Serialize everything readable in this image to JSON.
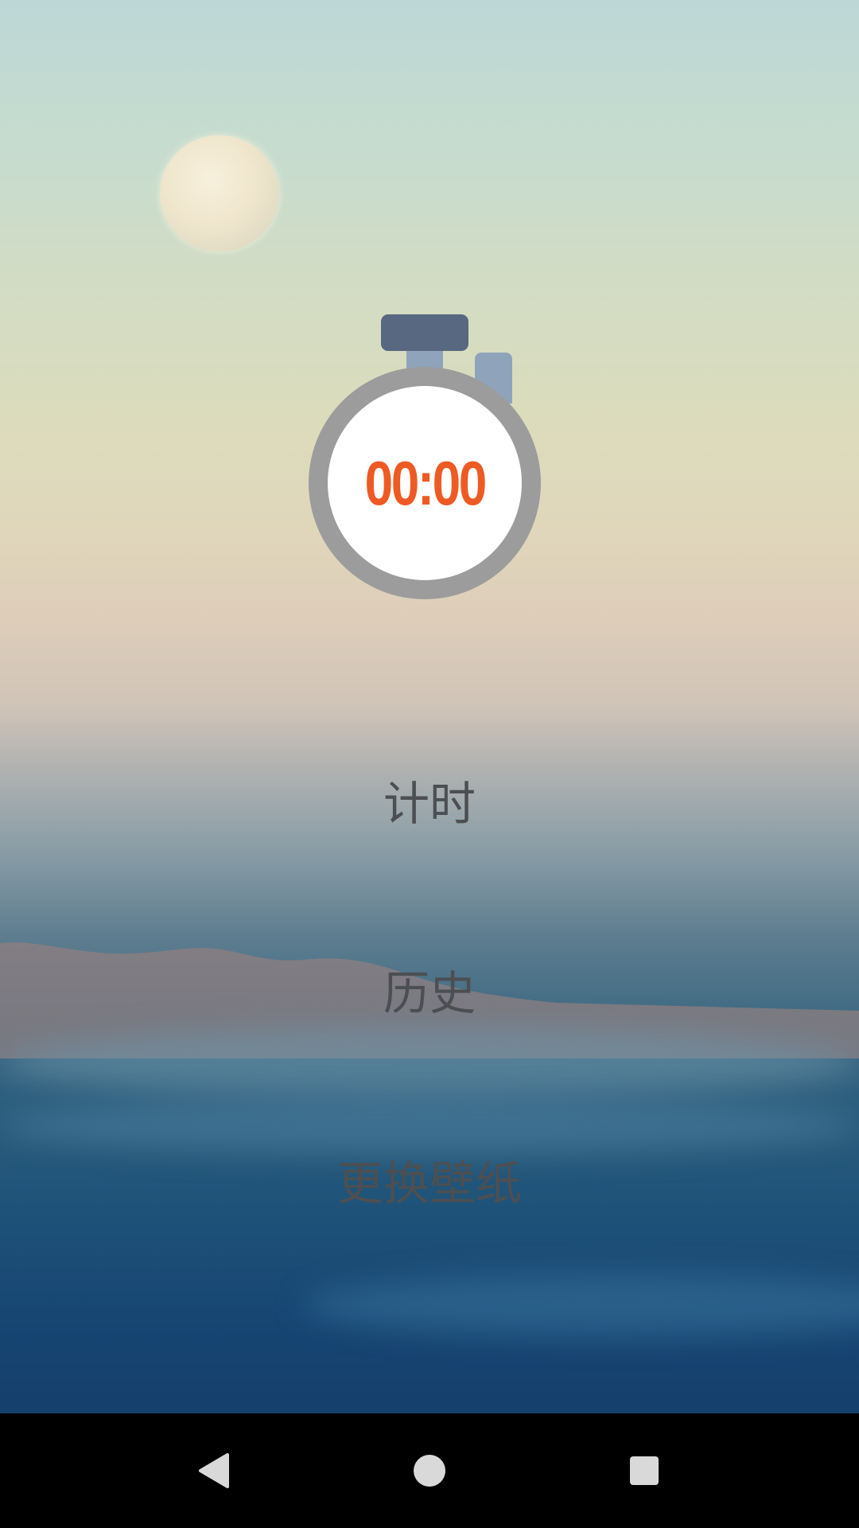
{
  "timer": {
    "display": "00:00"
  },
  "menu": {
    "items": [
      {
        "label": "计时"
      },
      {
        "label": "历史"
      },
      {
        "label": "更换壁纸"
      }
    ]
  },
  "navbar": {
    "back_icon": "back-triangle-icon",
    "home_icon": "home-circle-icon",
    "recents_icon": "recents-square-icon"
  },
  "colors": {
    "timer_digits": "#ee5a24",
    "menu_text": "#4c4f52",
    "stopwatch_ring": "#9c9c9c",
    "stopwatch_cap": "#586880",
    "stopwatch_stem": "#8fa4bb",
    "navbar": "#000000"
  }
}
